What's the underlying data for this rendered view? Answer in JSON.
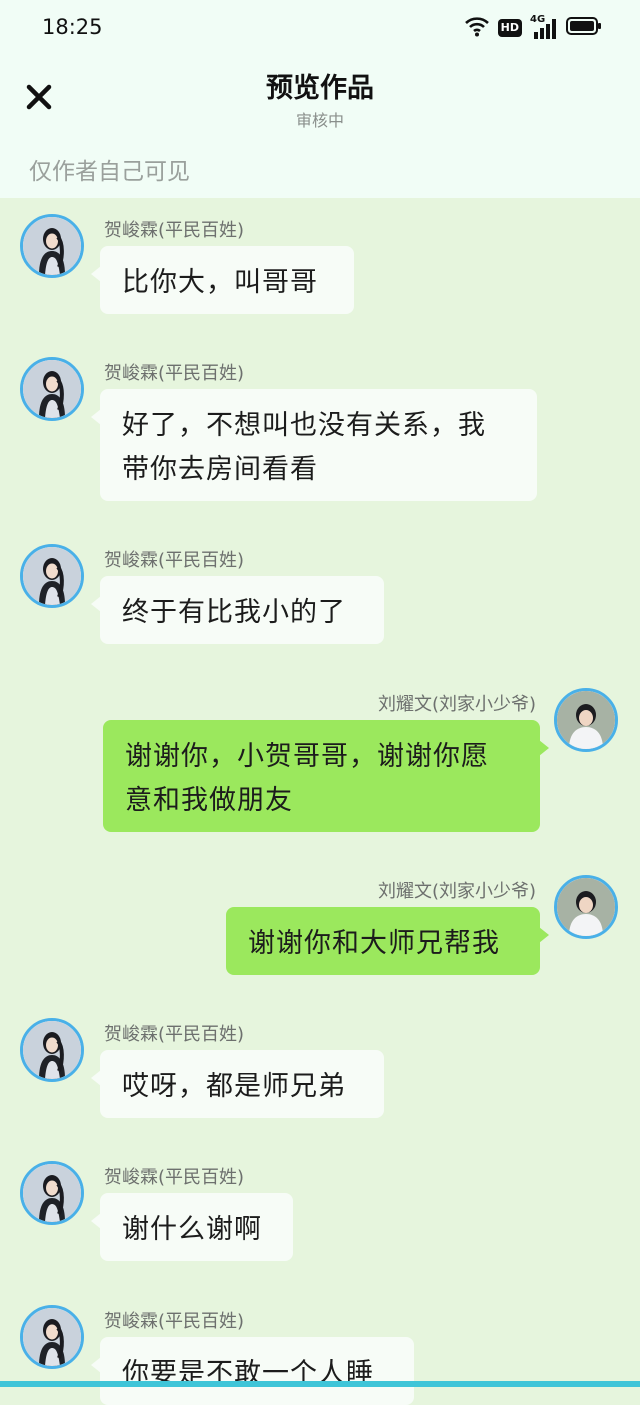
{
  "status_bar": {
    "time": "18:25",
    "badge": "HD",
    "network": "4G"
  },
  "header": {
    "close_icon": "close-icon",
    "title": "预览作品",
    "subtitle": "审核中",
    "visibility_note": "仅作者自己可见"
  },
  "characters": {
    "he": {
      "name": "贺峻霖(平民百姓)",
      "avatar_icon": "avatar-girl"
    },
    "liu": {
      "name": "刘耀文(刘家小少爷)",
      "avatar_icon": "avatar-boy"
    }
  },
  "messages": [
    {
      "speaker": "贺峻霖(平民百姓)",
      "side": "left",
      "text": "比你大，叫哥哥",
      "lines": [
        "比你大，叫哥哥"
      ]
    },
    {
      "speaker": "贺峻霖(平民百姓)",
      "side": "left",
      "text": "好了，不想叫也没有关系，我带你去房间看看",
      "lines": [
        "好了，不想叫也没有关系，我",
        "带你去房间看看"
      ]
    },
    {
      "speaker": "贺峻霖(平民百姓)",
      "side": "left",
      "text": "终于有比我小的了",
      "lines": [
        "终于有比我小的了"
      ]
    },
    {
      "speaker": "刘耀文(刘家小少爷)",
      "side": "right",
      "text": "谢谢你，小贺哥哥，谢谢你愿意和我做朋友",
      "lines": [
        "谢谢你，小贺哥哥，谢谢你愿",
        "意和我做朋友"
      ]
    },
    {
      "speaker": "刘耀文(刘家小少爷)",
      "side": "right",
      "text": "谢谢你和大师兄帮我",
      "lines": [
        "谢谢你和大师兄帮我"
      ]
    },
    {
      "speaker": "贺峻霖(平民百姓)",
      "side": "left",
      "text": "哎呀，都是师兄弟",
      "lines": [
        "哎呀，都是师兄弟"
      ]
    },
    {
      "speaker": "贺峻霖(平民百姓)",
      "side": "left",
      "text": "谢什么谢啊",
      "lines": [
        "谢什么谢啊"
      ]
    },
    {
      "speaker": "贺峻霖(平民百姓)",
      "side": "left",
      "text": "你要是不敢一个人睡",
      "lines": [
        "你要是不敢一个人睡"
      ]
    }
  ],
  "colors": {
    "background": "#e6f5dd",
    "header_bg": "#f1fdf6",
    "left_bubble": "#f7fcf7",
    "right_bubble": "#9be85d",
    "avatar_border": "#49b0e8"
  }
}
